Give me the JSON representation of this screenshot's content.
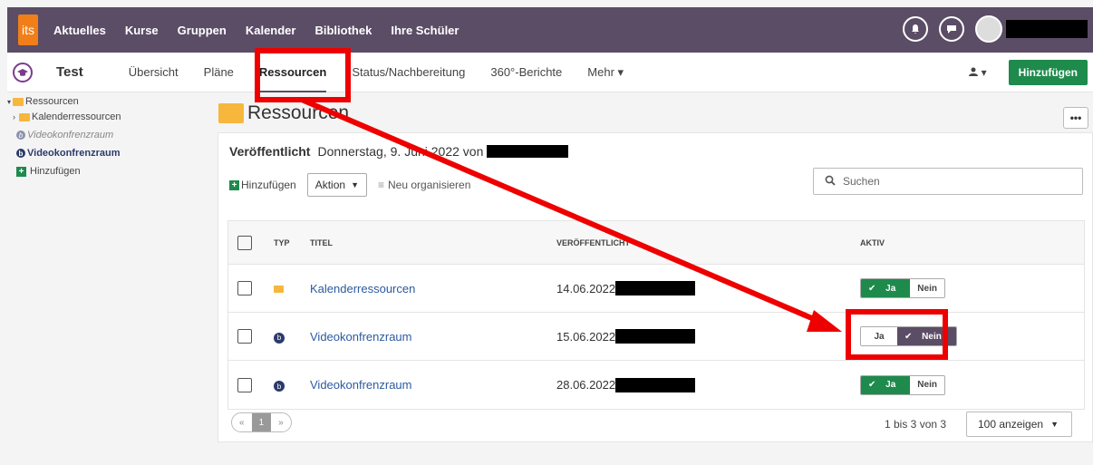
{
  "topnav": {
    "logo": "its",
    "links": [
      "Aktuelles",
      "Kurse",
      "Gruppen",
      "Kalender",
      "Bibliothek",
      "Ihre Schüler"
    ],
    "active": "Kurse",
    "bell_icon": "bell-icon",
    "chat_icon": "chat-icon"
  },
  "coursebar": {
    "title": "Test",
    "tabs": [
      "Übersicht",
      "Pläne",
      "Ressourcen",
      "Status/Nachbereitung",
      "360°-Berichte",
      "Mehr ▾"
    ],
    "user_dd": "▾",
    "add_label": "Hinzufügen"
  },
  "sidebar": {
    "root": "Ressourcen",
    "items": [
      {
        "label": "Kalenderressourcen"
      },
      {
        "label": "Videokonfrenzraum"
      },
      {
        "label": "Videokonfrenzraum"
      },
      {
        "label": "Hinzufügen"
      }
    ]
  },
  "main": {
    "title": "Ressourcen",
    "more_label": "•••",
    "published_label": "Veröffentlicht",
    "published_text": "Donnerstag, 9. Juni 2022 von",
    "toolbar": {
      "add": "Hinzufügen",
      "aktion": "Aktion",
      "reorg": "Neu organisieren"
    },
    "search_placeholder": "Suchen",
    "columns": {
      "typ": "TYP",
      "titel": "TITEL",
      "veroeff": "VERÖFFENTLICHT",
      "aktiv": "AKTIV"
    },
    "rows": [
      {
        "title": "Kalenderressourcen",
        "date": "14.06.2022",
        "type": "folder",
        "active": true
      },
      {
        "title": "Videokonfrenzraum",
        "date": "15.06.2022",
        "type": "bb",
        "active": false
      },
      {
        "title": "Videokonfrenzraum",
        "date": "28.06.2022",
        "type": "bb",
        "active": true
      }
    ],
    "toggle": {
      "ja": "Ja",
      "nein": "Nein"
    },
    "pager": {
      "prev": "«",
      "page": "1",
      "next": "»"
    },
    "row_count": "1 bis 3 von 3",
    "per_page": "100 anzeigen"
  },
  "colors": {
    "nav": "#5b4d66",
    "green": "#1e8a4c",
    "highlight": "#e00000"
  }
}
